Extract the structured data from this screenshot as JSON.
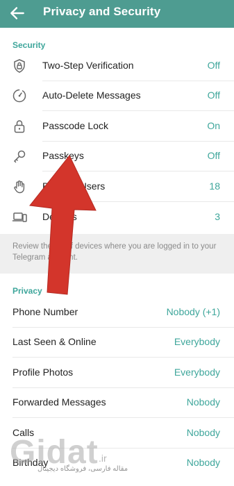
{
  "header": {
    "title": "Privacy and Security"
  },
  "security": {
    "heading": "Security",
    "items": [
      {
        "label": "Two-Step Verification",
        "value": "Off",
        "icon": "shield-lock-icon"
      },
      {
        "label": "Auto-Delete Messages",
        "value": "Off",
        "icon": "timer-icon"
      },
      {
        "label": "Passcode Lock",
        "value": "On",
        "icon": "lock-icon"
      },
      {
        "label": "Passkeys",
        "value": "Off",
        "icon": "key-icon"
      },
      {
        "label": "Blocked Users",
        "value": "18",
        "icon": "hand-icon"
      },
      {
        "label": "Devices",
        "value": "3",
        "icon": "devices-icon"
      }
    ],
    "info": "Review the list of devices where you are logged in to your Telegram account."
  },
  "privacy": {
    "heading": "Privacy",
    "items": [
      {
        "label": "Phone Number",
        "value": "Nobody (+1)"
      },
      {
        "label": "Last Seen & Online",
        "value": "Everybody"
      },
      {
        "label": "Profile Photos",
        "value": "Everybody"
      },
      {
        "label": "Forwarded Messages",
        "value": "Nobody"
      },
      {
        "label": "Calls",
        "value": "Nobody"
      },
      {
        "label": "Birthday",
        "value": "Nobody"
      }
    ]
  },
  "watermark": {
    "logo": "Gidat",
    "domain": ".ir",
    "tagline": "مقاله فارسی، فروشگاه دیجیتال"
  },
  "colors": {
    "header": "#4e9c91",
    "accent": "#3ea69b",
    "arrow": "#d3352b"
  }
}
